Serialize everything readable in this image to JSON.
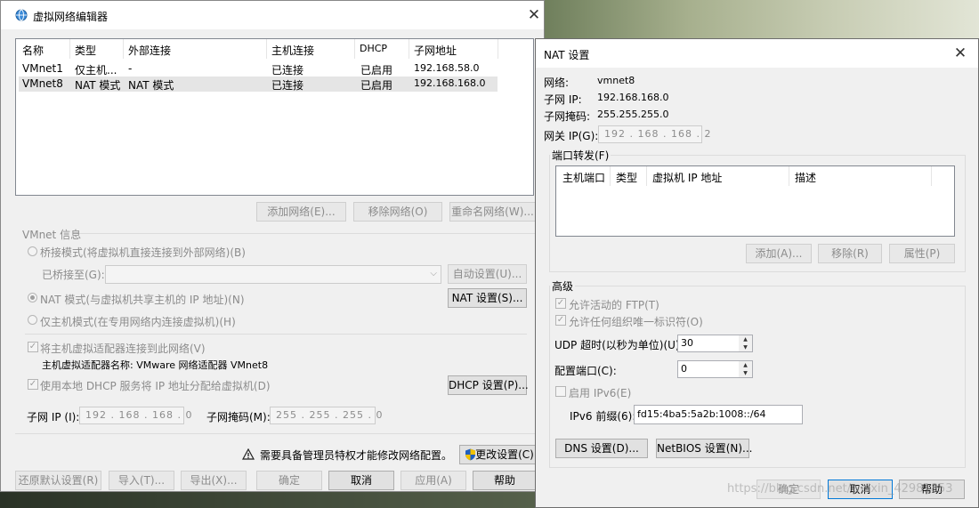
{
  "vne": {
    "title": "虚拟网络编辑器",
    "table": {
      "headers": [
        "名称",
        "类型",
        "外部连接",
        "主机连接",
        "DHCP",
        "子网地址"
      ],
      "rows": [
        [
          "VMnet1",
          "仅主机...",
          "-",
          "已连接",
          "已启用",
          "192.168.58.0"
        ],
        [
          "VMnet8",
          "NAT 模式",
          "NAT 模式",
          "已连接",
          "已启用",
          "192.168.168.0"
        ]
      ]
    },
    "add_network": "添加网络(E)...",
    "remove_network": "移除网络(O)",
    "rename_network": "重命名网络(W)...",
    "vmnet_info": "VMnet 信息",
    "bridged_mode": "桥接模式(将虚拟机直接连接到外部网络)(B)",
    "bridged_to_label": "已桥接至(G):",
    "auto_settings": "自动设置(U)...",
    "nat_mode": "NAT 模式(与虚拟机共享主机的 IP 地址)(N)",
    "nat_settings": "NAT 设置(S)...",
    "host_only_mode": "仅主机模式(在专用网络内连接虚拟机)(H)",
    "connect_adapter": "将主机虚拟适配器连接到此网络(V)",
    "adapter_name": "主机虚拟适配器名称: VMware 网络适配器 VMnet8",
    "use_dhcp": "使用本地 DHCP 服务将 IP 地址分配给虚拟机(D)",
    "dhcp_settings": "DHCP 设置(P)...",
    "subnet_ip_label": "子网 IP (I):",
    "subnet_ip": "192 . 168 . 168 .  0",
    "subnet_mask_label": "子网掩码(M):",
    "subnet_mask": "255 . 255 . 255 .  0",
    "admin_warning": "需要具备管理员特权才能修改网络配置。",
    "change_settings": "更改设置(C)",
    "restore_defaults": "还原默认设置(R)",
    "import": "导入(T)...",
    "export": "导出(X)...",
    "ok": "确定",
    "cancel": "取消",
    "apply": "应用(A)",
    "help": "帮助"
  },
  "nat": {
    "title": "NAT 设置",
    "network_label": "网络:",
    "network_value": "vmnet8",
    "subnet_ip_label": "子网 IP:",
    "subnet_ip_value": "192.168.168.0",
    "subnet_mask_label": "子网掩码:",
    "subnet_mask_value": "255.255.255.0",
    "gateway_label": "网关 IP(G):",
    "gateway_value": "192 . 168 . 168 .  2",
    "port_forwarding": "端口转发(F)",
    "pf_headers": [
      "主机端口",
      "类型",
      "虚拟机 IP 地址",
      "描述"
    ],
    "add": "添加(A)...",
    "remove": "移除(R)",
    "properties": "属性(P)",
    "advanced": "高级",
    "allow_ftp": "允许活动的 FTP(T)",
    "allow_oui": "允许任何组织唯一标识符(O)",
    "udp_timeout_label": "UDP 超时(以秒为单位)(U):",
    "udp_timeout": "30",
    "config_port_label": "配置端口(C):",
    "config_port": "0",
    "enable_ipv6": "启用 IPv6(E)",
    "ipv6_prefix_label": "IPv6 前缀(6):",
    "ipv6_prefix": "fd15:4ba5:5a2b:1008::/64",
    "dns_settings": "DNS 设置(D)...",
    "netbios_settings": "NetBIOS 设置(N)...",
    "ok": "确定",
    "cancel": "取消",
    "help": "帮助"
  },
  "watermark": "https://blog.csdn.net/weixin_42981853",
  "colors": {
    "focus_border": "#0078d7",
    "disabled_text": "#8c8c8c",
    "shield_blue": "#1f5fbf",
    "shield_yellow": "#f2c200"
  }
}
